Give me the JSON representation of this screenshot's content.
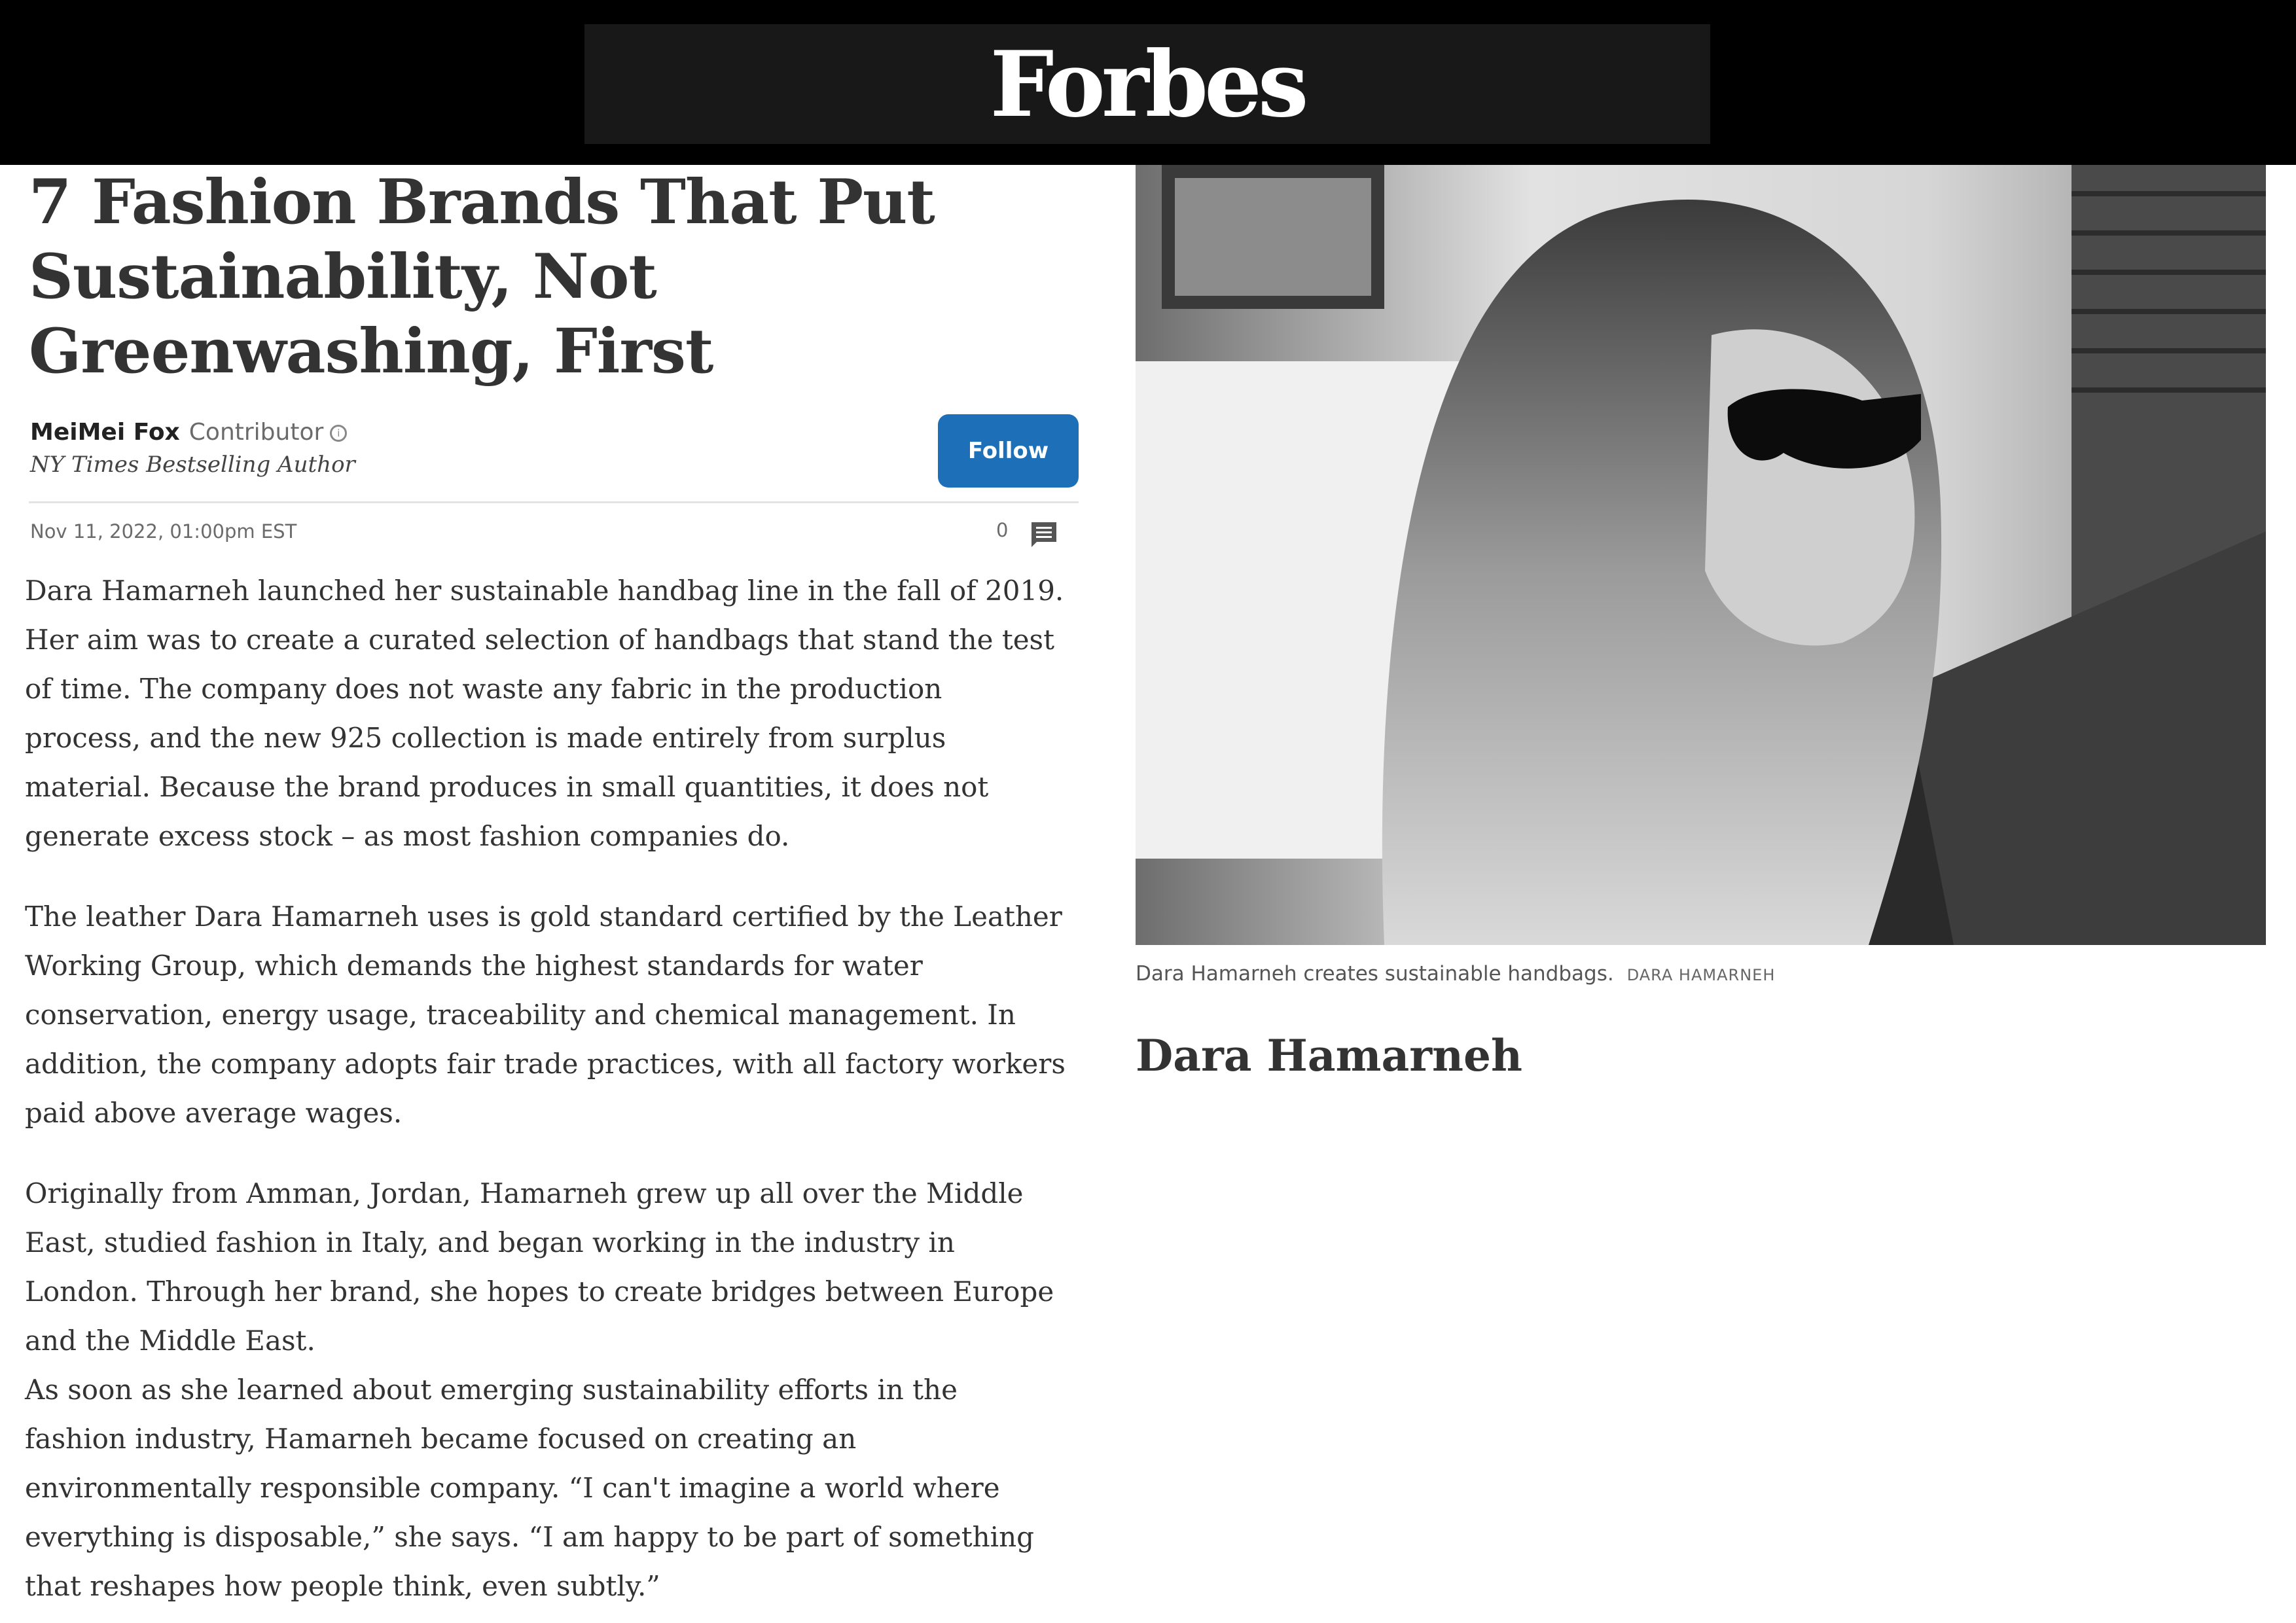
{
  "header": {
    "logo": "Forbes"
  },
  "article": {
    "headline": "7 Fashion Brands That Put Sustainability, Not Greenwashing, First",
    "author": {
      "name": "MeiMei Fox",
      "role": "Contributor",
      "title": "NY Times Bestselling Author",
      "follow_label": "Follow"
    },
    "date": "Nov 11, 2022, 01:00pm EST",
    "comment_count": "0",
    "paragraphs": [
      "Dara Hamarneh launched her sustainable handbag line in the fall of 2019. Her aim was to create a curated selection of handbags that stand the test of time. The company does not waste any fabric in the production process, and the new 925 collection is made entirely from surplus material. Because the brand produces in small quantities, it does not generate excess stock – as most fashion companies do.",
      "The leather Dara Hamarneh uses is gold standard certified by the Leather Working Group, which demands the highest standards for water conservation, energy usage, traceability and chemical management. In addition, the company adopts fair trade practices, with all factory workers paid above average wages.",
      "Originally from Amman, Jordan, Hamarneh grew up all over the Middle East, studied fashion in Italy, and began working in the industry in London. Through her brand, she hopes to create bridges between Europe and the Middle East.",
      "As soon as she learned about emerging sustainability efforts in the fashion industry, Hamarneh became focused on creating an environmentally responsible company. “I can't imagine a world where everything is disposable,” she says. “I am happy to be part of something that reshapes how people think, even subtly.”"
    ]
  },
  "sidebar": {
    "photo_caption": "Dara Hamarneh creates sustainable handbags.",
    "photo_credit": "DARA HAMARNEH",
    "heading": "Dara Hamarneh"
  }
}
